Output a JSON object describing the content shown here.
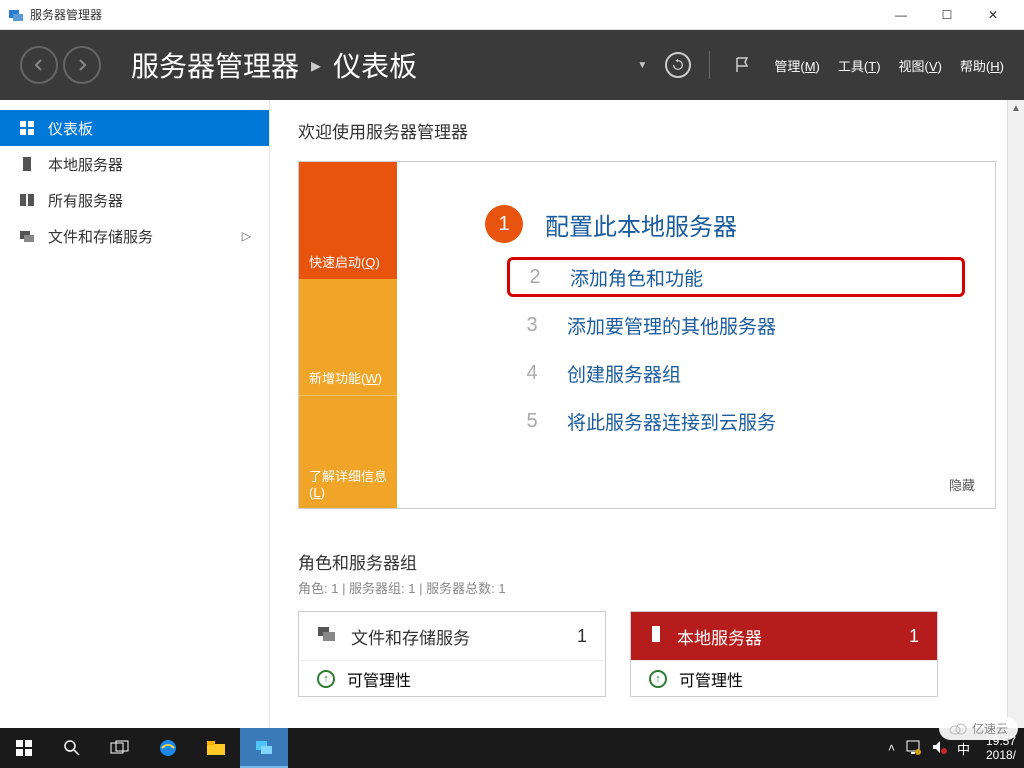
{
  "window": {
    "title": "服务器管理器",
    "minimize": "—",
    "maximize": "☐",
    "close": "✕"
  },
  "header": {
    "app_name": "服务器管理器",
    "page": "仪表板",
    "menus": {
      "manage": "管理",
      "manage_key": "M",
      "tools": "工具",
      "tools_key": "T",
      "view": "视图",
      "view_key": "V",
      "help": "帮助",
      "help_key": "H"
    }
  },
  "sidebar": {
    "items": [
      {
        "label": "仪表板",
        "icon": "dashboard"
      },
      {
        "label": "本地服务器",
        "icon": "server"
      },
      {
        "label": "所有服务器",
        "icon": "servers"
      },
      {
        "label": "文件和存储服务",
        "icon": "storage",
        "has_submenu": true
      }
    ]
  },
  "welcome": {
    "title": "欢迎使用服务器管理器",
    "tiles": {
      "quick": "快速启动",
      "quick_key": "Q",
      "whatsnew": "新增功能",
      "whatsnew_key": "W",
      "learn": "了解详细信息",
      "learn_key": "L"
    },
    "main_step": {
      "num": "1",
      "label": "配置此本地服务器"
    },
    "steps": [
      {
        "num": "2",
        "label": "添加角色和功能"
      },
      {
        "num": "3",
        "label": "添加要管理的其他服务器"
      },
      {
        "num": "4",
        "label": "创建服务器组"
      },
      {
        "num": "5",
        "label": "将此服务器连接到云服务"
      }
    ],
    "hide": "隐藏"
  },
  "roles": {
    "title": "角色和服务器组",
    "subtitle": "角色: 1 | 服务器组: 1 | 服务器总数: 1",
    "cards": [
      {
        "title": "文件和存储服务",
        "count": "1",
        "color": "gray",
        "status": "可管理性"
      },
      {
        "title": "本地服务器",
        "count": "1",
        "color": "red",
        "status": "可管理性"
      }
    ]
  },
  "taskbar": {
    "time": "19:57",
    "date": "2018/"
  },
  "watermark": "亿速云"
}
